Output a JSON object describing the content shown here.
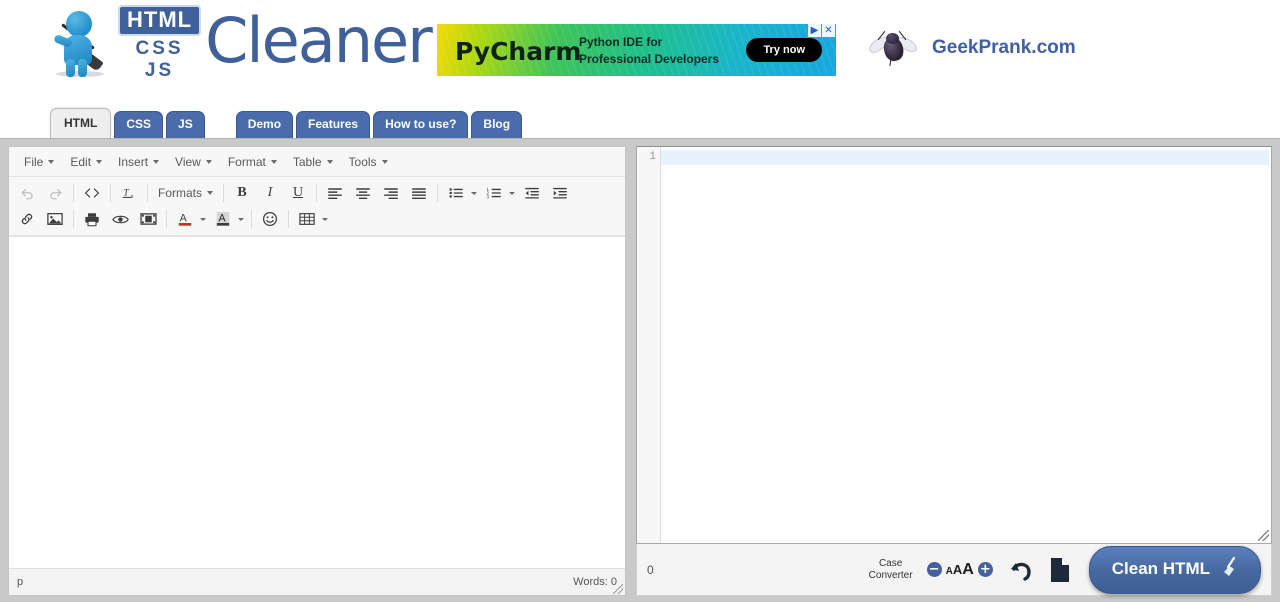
{
  "site": {
    "logo": {
      "badge_html": "HTML",
      "line_css": "CSS",
      "line_js": "JS",
      "word": "Cleaner",
      "mascot_icon": "cleaner-mascot-icon"
    },
    "partner": {
      "name": "GeekPrank.com",
      "icon": "fly-icon"
    }
  },
  "ad": {
    "brand": "PyCharm",
    "line1": "Python IDE for",
    "line2": "Professional Developers",
    "cta": "Try now",
    "adchoices_icon": "adchoices-icon",
    "close_icon": "close-icon"
  },
  "tabs": {
    "primary": [
      {
        "label": "HTML",
        "active": true
      },
      {
        "label": "CSS",
        "active": false
      },
      {
        "label": "JS",
        "active": false
      }
    ],
    "secondary": [
      {
        "label": "Demo"
      },
      {
        "label": "Features"
      },
      {
        "label": "How to use?"
      },
      {
        "label": "Blog"
      }
    ]
  },
  "editor": {
    "menus": [
      "File",
      "Edit",
      "Insert",
      "View",
      "Format",
      "Table",
      "Tools"
    ],
    "toolbar_row1": [
      {
        "name": "undo-icon",
        "glyph": "↶",
        "disabled": true
      },
      {
        "name": "redo-icon",
        "glyph": "↷",
        "disabled": true
      },
      {
        "name": "source-code-icon",
        "glyph": "<>"
      },
      {
        "name": "clear-formatting-icon",
        "glyph": "Tx"
      },
      {
        "name": "formats-dropdown",
        "label": "Formats"
      },
      {
        "name": "bold-icon",
        "glyph": "B"
      },
      {
        "name": "italic-icon",
        "glyph": "I"
      },
      {
        "name": "underline-icon",
        "glyph": "U"
      },
      {
        "name": "align-left-icon"
      },
      {
        "name": "align-center-icon"
      },
      {
        "name": "align-right-icon"
      },
      {
        "name": "align-justify-icon"
      },
      {
        "name": "bullet-list-icon"
      },
      {
        "name": "numbered-list-icon"
      },
      {
        "name": "outdent-icon"
      },
      {
        "name": "indent-icon"
      }
    ],
    "toolbar_row2": [
      {
        "name": "link-icon"
      },
      {
        "name": "image-icon"
      },
      {
        "name": "print-icon"
      },
      {
        "name": "preview-icon"
      },
      {
        "name": "media-icon"
      },
      {
        "name": "text-color-icon"
      },
      {
        "name": "background-color-icon"
      },
      {
        "name": "emoticon-icon"
      },
      {
        "name": "table-icon"
      }
    ],
    "formats_label": "Formats",
    "content": "",
    "status": {
      "element_path": "p",
      "word_count_label": "Words:",
      "word_count": "0"
    }
  },
  "code_panel": {
    "line_numbers": [
      "1"
    ],
    "content": "",
    "char_count": "0",
    "controls": {
      "case_converter_line1": "Case",
      "case_converter_line2": "Converter",
      "decrease_font": "−",
      "increase_font": "+",
      "font_sizes": "AAA",
      "undo_icon": "undo-icon",
      "new_document_icon": "new-document-icon",
      "clean_button": "Clean HTML",
      "broom_icon": "broom-icon"
    }
  },
  "colors": {
    "brand_blue": "#3f6099",
    "tab_blue": "#4a6cab",
    "button_blue": "#44619f",
    "page_gray": "#c9c9c9",
    "active_line": "#e8f2fe"
  }
}
